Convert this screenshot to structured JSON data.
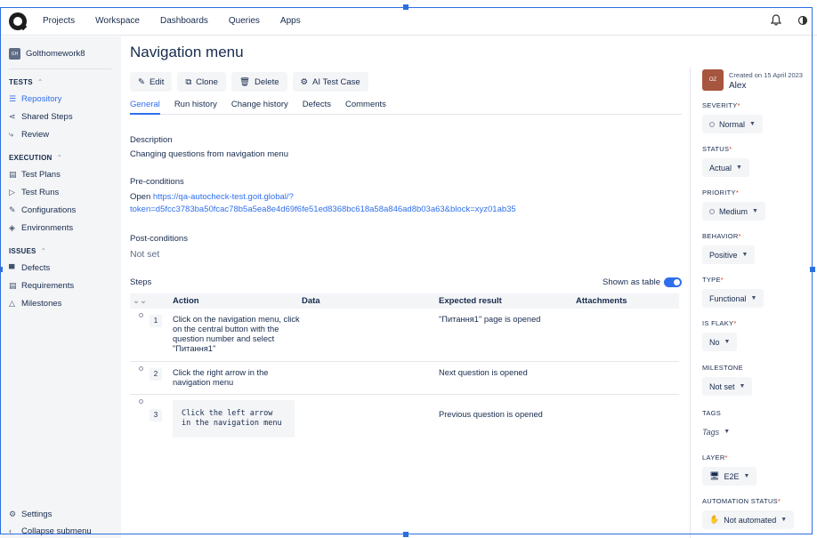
{
  "nav": {
    "links": [
      "Projects",
      "Workspace",
      "Dashboards",
      "Queries",
      "Apps"
    ]
  },
  "sidebar": {
    "project_initials": "GH",
    "project_name": "Golthomework8",
    "tests_header": "TESTS",
    "tests_items": [
      {
        "label": "Repository",
        "icon": "repository-icon",
        "glyph": "☰"
      },
      {
        "label": "Shared Steps",
        "icon": "share-icon",
        "glyph": "⋖"
      },
      {
        "label": "Review",
        "icon": "review-icon",
        "glyph": "⤷"
      }
    ],
    "execution_header": "EXECUTION",
    "execution_items": [
      {
        "label": "Test Plans",
        "icon": "test-plans-icon",
        "glyph": "▤"
      },
      {
        "label": "Test Runs",
        "icon": "play-icon",
        "glyph": "▷"
      },
      {
        "label": "Configurations",
        "icon": "wrench-icon",
        "glyph": "✎"
      },
      {
        "label": "Environments",
        "icon": "environment-icon",
        "glyph": "◈"
      }
    ],
    "issues_header": "ISSUES",
    "issues_items": [
      {
        "label": "Defects",
        "icon": "bug-icon",
        "glyph": "▀"
      },
      {
        "label": "Requirements",
        "icon": "requirements-icon",
        "glyph": "▤"
      },
      {
        "label": "Milestones",
        "icon": "milestone-icon",
        "glyph": "△"
      }
    ],
    "settings": "Settings",
    "collapse": "Collapse submenu"
  },
  "main": {
    "title": "Navigation menu",
    "buttons": {
      "edit": "Edit",
      "clone": "Clone",
      "delete": "Delete",
      "ai": "AI Test Case"
    },
    "tabs": [
      "General",
      "Run history",
      "Change history",
      "Defects",
      "Comments"
    ],
    "description_label": "Description",
    "description_value": "Changing questions from navigation menu",
    "preconditions_label": "Pre-conditions",
    "preconditions_prefix": "Open ",
    "preconditions_link_1": "https://qa-autocheck-test.goit.global/?",
    "preconditions_link_2": "token=d5fcc3783ba50fcac78b5a5ea8e4d69f6fe51ed8368bc618a58a846ad8b03a63&block=xyz01ab35",
    "postconditions_label": "Post-conditions",
    "postconditions_value": "Not set",
    "steps_label": "Steps",
    "shown_as_table": "Shown as table",
    "columns": [
      "Action",
      "Data",
      "Expected result",
      "Attachments"
    ],
    "steps": [
      {
        "num": "1",
        "action": "Click on the navigation menu, click on the central button with the question number and select \"Питання1\"",
        "data": "",
        "expected": "\"Питання1\" page is opened"
      },
      {
        "num": "2",
        "action": "Click the right arrow in the navigation menu",
        "data": "",
        "expected": "Next question is opened"
      },
      {
        "num": "3",
        "action": "Click the left arrow\nin the navigation menu",
        "data": "",
        "expected": "Previous question is opened"
      }
    ]
  },
  "panel": {
    "avatar": "OZ",
    "created": "Created on 15 April 2023",
    "author": "Alex",
    "severity_label": "SEVERITY",
    "severity": "Normal",
    "status_label": "STATUS",
    "status": "Actual",
    "priority_label": "PRIORITY",
    "priority": "Medium",
    "behavior_label": "BEHAVIOR",
    "behavior": "Positive",
    "type_label": "TYPE",
    "type": "Functional",
    "flaky_label": "IS FLAKY",
    "flaky": "No",
    "milestone_label": "MILESTONE",
    "milestone": "Not set",
    "tags_label": "TAGS",
    "tags": "Tags",
    "layer_label": "LAYER",
    "layer": "E2E",
    "automation_label": "AUTOMATION STATUS",
    "automation": "Not automated",
    "required_mark": "*"
  }
}
